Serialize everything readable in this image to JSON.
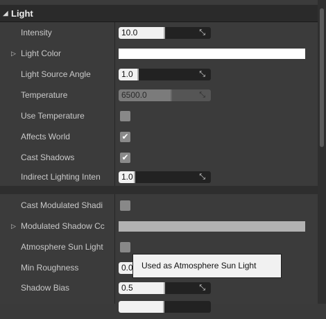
{
  "category": {
    "arrow_icon": "collapse-triangle-icon",
    "title": "Light"
  },
  "properties": {
    "intensity": {
      "label": "Intensity",
      "value": "10.0",
      "fill": 0.5
    },
    "light_color": {
      "label": "Light Color",
      "color": "#ffffff"
    },
    "light_source_angle": {
      "label": "Light Source Angle",
      "value": "1.0",
      "fill": 0.22
    },
    "temperature": {
      "label": "Temperature",
      "value": "6500.0",
      "fill": 0.58
    },
    "use_temperature": {
      "label": "Use Temperature",
      "checked": false
    },
    "affects_world": {
      "label": "Affects World",
      "checked": true
    },
    "cast_shadows": {
      "label": "Cast Shadows",
      "checked": true
    },
    "indirect_lighting": {
      "label": "Indirect Lighting Inten",
      "value": "1.0",
      "fill": 0.18
    },
    "cast_modulated": {
      "label": "Cast Modulated Shadi",
      "checked": false
    },
    "modulated_shadow_color": {
      "label": "Modulated Shadow Cc",
      "color": "#b2b2b2"
    },
    "atmosphere_sun": {
      "label": "Atmosphere Sun Light",
      "checked": false
    },
    "min_roughness": {
      "label": "Min Roughness",
      "value": "0.0"
    },
    "shadow_bias": {
      "label": "Shadow Bias",
      "value": "0.5",
      "fill": 0.5
    }
  },
  "tooltip": {
    "text": "Used as Atmosphere Sun Light"
  },
  "check_glyph": "✔",
  "colors": {
    "header_bg": "#2a2a2a",
    "panel_bg": "#3b3b3b",
    "numbox_fill": "#f1f1f1"
  }
}
